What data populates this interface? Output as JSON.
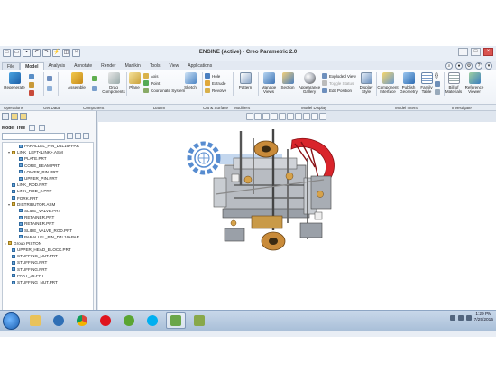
{
  "window": {
    "title": "ENGINE (Active) - Creo Parametric 2.0",
    "controls": [
      "minimize",
      "maximize",
      "close"
    ]
  },
  "quick_access": [
    "new-icon",
    "open-icon",
    "save-icon",
    "undo-icon",
    "redo-icon",
    "regenerate-icon",
    "windows-icon",
    "close-icon"
  ],
  "tabs": [
    "File",
    "Model",
    "Analysis",
    "Annotate",
    "Render",
    "Manikin",
    "Tools",
    "View",
    "Applications"
  ],
  "active_tab": "Model",
  "ribbon": {
    "regenerate": "Regenerate",
    "assemble": "Assemble",
    "drag_components": "Drag Components",
    "plane": "Plane",
    "axis": "Axis",
    "point": "Point",
    "coordinate_system": "Coordinate System",
    "sketch": "Sketch",
    "hole": "Hole",
    "extrude": "Extrude",
    "revolve": "Revolve",
    "pattern": "Pattern",
    "manage_views": "Manage Views",
    "section": "Section",
    "appearance_gallery": "Appearance Gallery",
    "exploded_view": "Exploded View",
    "toggle_status": "Toggle Status",
    "edit_position": "Edit Position",
    "display_style": "Display Style",
    "component_interface": "Component Interface",
    "publish_geometry": "Publish Geometry",
    "family_table": "Family Table",
    "bill_of_materials": "Bill of Materials",
    "reference_viewer": "Reference Viewer"
  },
  "groups": [
    "Operations",
    "Get Data",
    "Component",
    "Datum",
    "Cut & Surface",
    "Modifiers",
    "Model Display",
    "Model Intent",
    "Investigate"
  ],
  "model_tree": {
    "title": "Model Tree",
    "items": [
      {
        "label": "PARALLEL_PIN_D4L16+PAR",
        "type": "prt",
        "indent": 3
      },
      {
        "label": "LINK_LEFT<LINK>.ASM",
        "type": "asm",
        "indent": 1,
        "toggle": "▾"
      },
      {
        "label": "PLATE.PRT",
        "type": "prt",
        "indent": 3
      },
      {
        "label": "CORE_BEAM.PRT",
        "type": "prt",
        "indent": 3
      },
      {
        "label": "LOWER_PIN.PRT",
        "type": "prt",
        "indent": 3
      },
      {
        "label": "UPPER_PIN.PRT",
        "type": "prt",
        "indent": 3
      },
      {
        "label": "LINK_ROD.PRT",
        "type": "prt",
        "indent": 1
      },
      {
        "label": "LINK_ROD_2.PRT",
        "type": "prt",
        "indent": 1
      },
      {
        "label": "FORK.PRT",
        "type": "prt",
        "indent": 1
      },
      {
        "label": "DISTRIBUTOR.ASM",
        "type": "asm",
        "indent": 1,
        "toggle": "▾"
      },
      {
        "label": "SLIDE_VALVE.PRT",
        "type": "prt",
        "indent": 3
      },
      {
        "label": "RETAINER.PRT",
        "type": "prt",
        "indent": 3
      },
      {
        "label": "RETAINER.PRT",
        "type": "prt",
        "indent": 3
      },
      {
        "label": "SLIDE_VALVE_ROD.PRT",
        "type": "prt",
        "indent": 3
      },
      {
        "label": "PARALLEL_PIN_D4L16+PAR",
        "type": "prt",
        "indent": 3
      },
      {
        "label": "Group PISTON",
        "type": "asm",
        "indent": 0,
        "toggle": "▸"
      },
      {
        "label": "UPPER_HEAD_BLOCK.PRT",
        "type": "prt",
        "indent": 1
      },
      {
        "label": "STUFFING_NUT.PRT",
        "type": "prt",
        "indent": 1
      },
      {
        "label": "STUFFING.PRT",
        "type": "prt",
        "indent": 1
      },
      {
        "label": "STUFFING.PRT",
        "type": "prt",
        "indent": 1
      },
      {
        "label": "PART_36.PRT",
        "type": "prt",
        "indent": 1
      },
      {
        "label": "STUFFING_NUT.PRT",
        "type": "prt",
        "indent": 1
      }
    ]
  },
  "status": {
    "message": "Shaded with edges model will be displayed",
    "selection_filter": "Smart"
  },
  "taskbar": {
    "apps": [
      "explorer",
      "media",
      "chrome",
      "opera",
      "utorrent",
      "skype",
      "creo",
      "creo-2"
    ],
    "time": "1:29 PM",
    "date": "7/25/2015"
  },
  "colors": {
    "accent": "#2a5ca8",
    "ribbon_bg": "#eef2f7",
    "taskbar": "#b4c8df"
  }
}
